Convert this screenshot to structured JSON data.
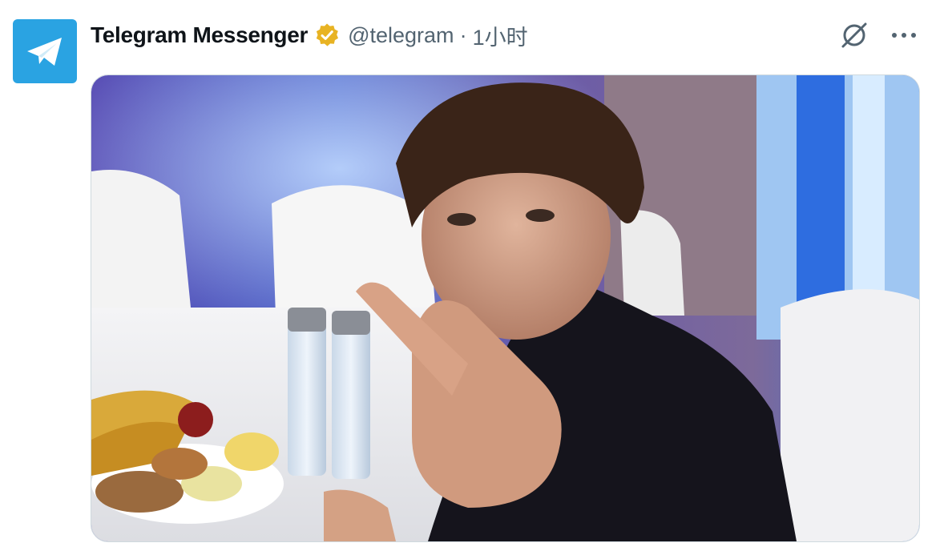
{
  "tweet": {
    "author_name": "Telegram Messenger",
    "handle": "@telegram",
    "separator": "·",
    "time": "1小时",
    "verified": true,
    "accent_color": "#2aa3e2",
    "verified_color": "#e8b323"
  },
  "icons": {
    "avatar": "telegram-paper-plane-icon",
    "verified": "verified-badge-icon",
    "grok": "grok-icon",
    "more": "more-options-icon"
  },
  "media": {
    "type": "photo"
  }
}
